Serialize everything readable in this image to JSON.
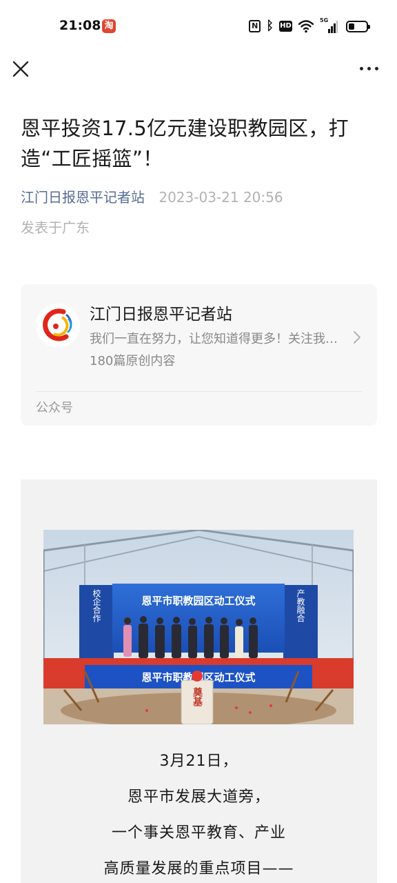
{
  "status_bar": {
    "time": "21:08",
    "app_badge": "淘",
    "nfc": "N",
    "bluetooth": "ᛒ",
    "hd": "HD",
    "signal_label": "5G",
    "battery_level": 0.35
  },
  "nav": {
    "close_icon": "close-icon",
    "more_icon": "more-icon"
  },
  "article": {
    "title": "恩平投资17.5亿元建设职教园区，打造“工匠摇篮”！",
    "author": "江门日报恩平记者站",
    "date": "2023-03-21 20:56",
    "region": "发表于广东"
  },
  "account_card": {
    "name": "江门日报恩平记者站",
    "description": "我们一直在努力，让您知道得更多！关注我们，获取更多资讯",
    "count": "180篇原创内容",
    "type_label": "公众号"
  },
  "photo": {
    "banner_text": "恩平市职教园区动工仪式",
    "left_panel": "校企合作",
    "right_panel": "产教融合",
    "stage_text": "恩平市职教园区动工仪式",
    "stone_text": "奠基"
  },
  "paragraphs": [
    "3月21日，",
    "恩平市发展大道旁，",
    "一个事关恩平教育、产业",
    "高质量发展的重点项目——"
  ],
  "colors": {
    "author_link": "#576b95",
    "card_bg": "#f7f7f7",
    "content_bg": "#f2f2f2"
  }
}
